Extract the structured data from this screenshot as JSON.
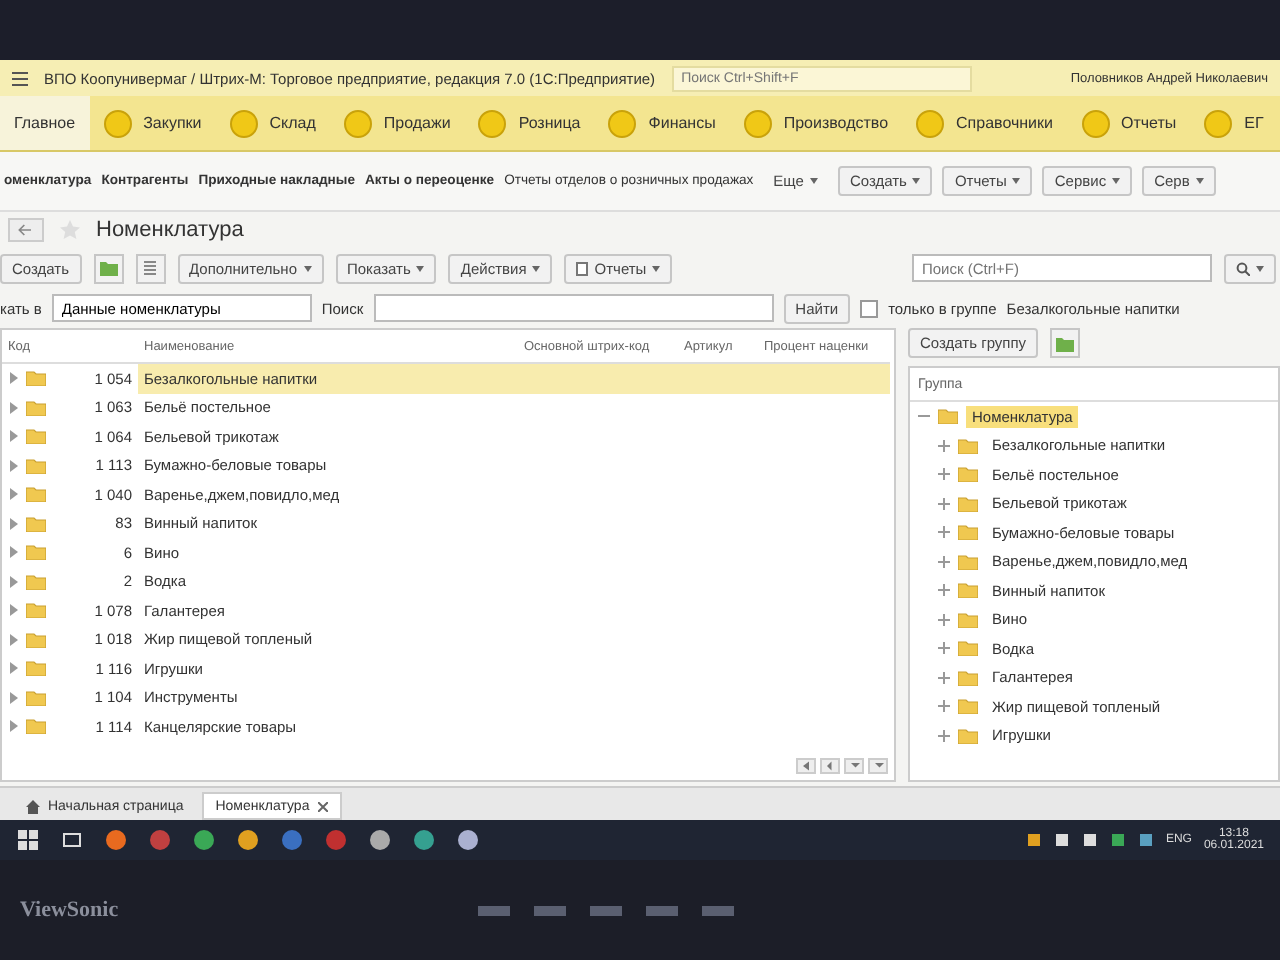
{
  "window": {
    "title": "ВПО Коопунивермаг / Штрих-М: Торговое предприятие, редакция 7.0  (1С:Предприятие)",
    "search_placeholder": "Поиск Ctrl+Shift+F",
    "user": "Половников Андрей Николаевич"
  },
  "sections": [
    {
      "label": "Главное",
      "selected": true
    },
    {
      "label": "Закупки",
      "selected": false
    },
    {
      "label": "Склад",
      "selected": false
    },
    {
      "label": "Продажи",
      "selected": false
    },
    {
      "label": "Розница",
      "selected": false
    },
    {
      "label": "Финансы",
      "selected": false
    },
    {
      "label": "Производство",
      "selected": false
    },
    {
      "label": "Справочники",
      "selected": false
    },
    {
      "label": "Отчеты",
      "selected": false
    },
    {
      "label": "ЕГ",
      "selected": false
    }
  ],
  "nav": {
    "links": [
      {
        "label": "оменклатура",
        "kind": "bold"
      },
      {
        "label": "Контрагенты",
        "kind": "bold"
      },
      {
        "label": "Приходные накладные",
        "kind": "bold"
      },
      {
        "label": "Акты о переоценке",
        "kind": "bold"
      },
      {
        "label": "Отчеты отделов о розничных продажах",
        "kind": "plain"
      }
    ],
    "more": "Еще",
    "buttons": [
      "Создать",
      "Отчеты",
      "Сервис",
      "Серв"
    ]
  },
  "form": {
    "title": "Номенклатура",
    "toolbar": [
      {
        "kind": "button",
        "label": "Создать"
      },
      {
        "kind": "add-folder"
      },
      {
        "kind": "list"
      },
      {
        "kind": "menu",
        "label": "Дополнительно"
      },
      {
        "kind": "menu",
        "label": "Показать"
      },
      {
        "kind": "menu",
        "label": "Действия"
      },
      {
        "kind": "report",
        "label": "Отчеты"
      }
    ],
    "search_placeholder": "Поиск (Ctrl+F)",
    "filter": {
      "search_in_label": "кать в",
      "search_in_value": "Данные номенклатуры",
      "search_label": "Поиск",
      "find_button": "Найти",
      "only_group": {
        "label": "только в группе",
        "checked": false
      },
      "group_name": "Безалкогольные напитки"
    },
    "table": {
      "columns": [
        "Код",
        "Наименование",
        "Основной штрих-код",
        "Артикул",
        "Процент наценки"
      ],
      "rows": [
        {
          "code": "1 054",
          "name": "Безалкогольные напитки",
          "selected": true
        },
        {
          "code": "1 063",
          "name": "Бельё постельное",
          "selected": false
        },
        {
          "code": "1 064",
          "name": "Бельевой трикотаж",
          "selected": false
        },
        {
          "code": "1 113",
          "name": "Бумажно-беловые товары",
          "selected": false
        },
        {
          "code": "1 040",
          "name": "Варенье,джем,повидло,мед",
          "selected": false
        },
        {
          "code": "83",
          "name": "Винный напиток",
          "selected": false
        },
        {
          "code": "6",
          "name": "Вино",
          "selected": false
        },
        {
          "code": "2",
          "name": "Водка",
          "selected": false
        },
        {
          "code": "1 078",
          "name": "Галантерея",
          "selected": false
        },
        {
          "code": "1 018",
          "name": "Жир пищевой топленый",
          "selected": false
        },
        {
          "code": "1 116",
          "name": "Игрушки",
          "selected": false
        },
        {
          "code": "1 104",
          "name": "Инструменты",
          "selected": false
        },
        {
          "code": "1 114",
          "name": "Канцелярские товары",
          "selected": false
        }
      ]
    },
    "groups": {
      "create_button": "Создать группу",
      "column": "Группа",
      "tree": [
        {
          "label": "Номенклатура",
          "expanded": true,
          "selected": true,
          "children": [
            {
              "label": "Безалкогольные напитки",
              "expanded": false,
              "selected": false
            },
            {
              "label": "Бельё постельное",
              "expanded": false,
              "selected": false
            },
            {
              "label": "Бельевой трикотаж",
              "expanded": false,
              "selected": false
            },
            {
              "label": "Бумажно-беловые товары",
              "expanded": false,
              "selected": false
            },
            {
              "label": "Варенье,джем,повидло,мед",
              "expanded": false,
              "selected": false
            },
            {
              "label": "Винный напиток",
              "expanded": false,
              "selected": false
            },
            {
              "label": "Вино",
              "expanded": false,
              "selected": false
            },
            {
              "label": "Водка",
              "expanded": false,
              "selected": false
            },
            {
              "label": "Галантерея",
              "expanded": false,
              "selected": false
            },
            {
              "label": "Жир пищевой топленый",
              "expanded": false,
              "selected": false
            },
            {
              "label": "Игрушки",
              "expanded": false,
              "selected": false
            }
          ]
        }
      ]
    }
  },
  "open_tabs": [
    {
      "kind": "home",
      "label": "Начальная страница",
      "selected": false
    },
    {
      "kind": "form",
      "label": "Номенклатура",
      "selected": true
    }
  ],
  "taskbar": {
    "lang": "ENG",
    "time": "13:18",
    "date": "06.01.2021"
  },
  "monitor": {
    "brand": "ViewSonic"
  }
}
